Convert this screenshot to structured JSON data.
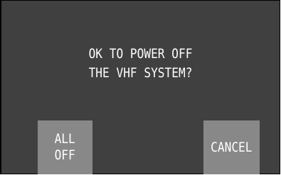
{
  "dialog": {
    "message_line1": "OK TO POWER OFF",
    "message_line2": "THE VHF SYSTEM?"
  },
  "buttons": {
    "all_off_line1": "ALL",
    "all_off_line2": "OFF",
    "cancel_label": "CANCEL"
  },
  "colors": {
    "screen_background": "#404040",
    "button_background": "#888888",
    "text": "#ffffff"
  }
}
